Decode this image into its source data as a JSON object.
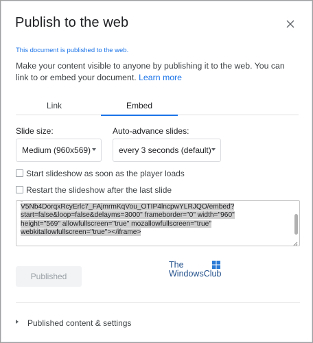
{
  "dialog": {
    "title": "Publish to the web",
    "notice": "This document is published to the web.",
    "description": "Make your content visible to anyone by publishing it to the web. You can link to or embed your document.",
    "learn_more": "Learn more"
  },
  "tabs": [
    {
      "label": "Link",
      "active": false
    },
    {
      "label": "Embed",
      "active": true
    }
  ],
  "embed": {
    "slide_size_label": "Slide size:",
    "slide_size_value": "Medium (960x569)",
    "auto_advance_label": "Auto-advance slides:",
    "auto_advance_value": "every 3 seconds (default)",
    "start_checkbox_label": "Start slideshow as soon as the player loads",
    "restart_checkbox_label": "Restart the slideshow after the last slide",
    "code_lines": [
      "V5Nb4DorqxRcyErlc7_FAjmrmKqVou_OTIP4lncpwYLRJQO/embed?",
      "start=false&loop=false&delayms=3000\" frameborder=\"0\" width=\"960\"",
      "height=\"569\" allowfullscreen=\"true\" mozallowfullscreen=\"true\"",
      "webkitallowfullscreen=\"true\"></iframe>"
    ]
  },
  "published_button": "Published",
  "watermark": {
    "line1": "The",
    "line2": "WindowsClub"
  },
  "footer": {
    "expander_label": "Published content & settings"
  },
  "colors": {
    "accent": "#1a73e8",
    "text": "#202124",
    "muted": "#9aa0a6"
  }
}
